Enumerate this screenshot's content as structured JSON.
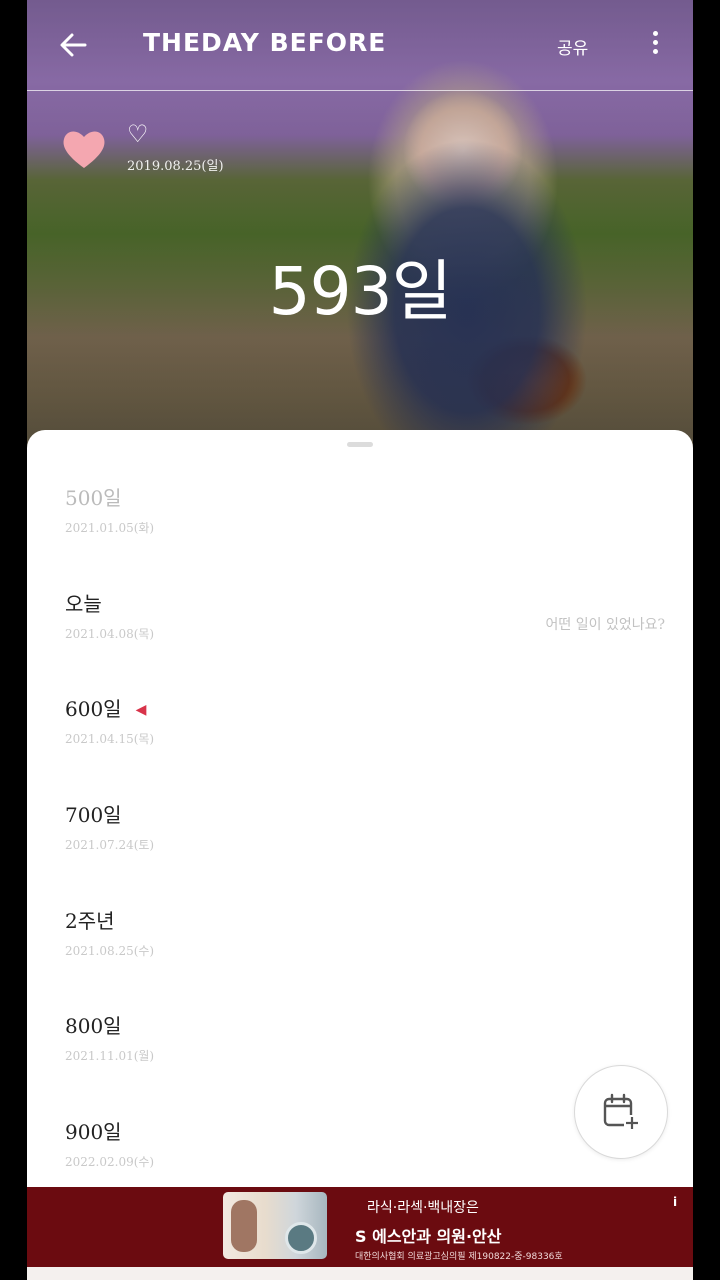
{
  "header": {
    "brand": "THEDAY BEFORE",
    "share_label": "공유"
  },
  "hero": {
    "title_icon": "♡",
    "start_date": "2019.08.25(일)",
    "count_text": "593일"
  },
  "milestones": [
    {
      "title": "500일",
      "date": "2021.01.05(화)",
      "state": "past"
    },
    {
      "title": "오늘",
      "date": "2021.04.08(목)",
      "note": "어떤 일이 있었나요?"
    },
    {
      "title": "600일",
      "date": "2021.04.15(목)",
      "flag": "◀"
    },
    {
      "title": "700일",
      "date": "2021.07.24(토)"
    },
    {
      "title": "2주년",
      "date": "2021.08.25(수)"
    },
    {
      "title": "800일",
      "date": "2021.11.01(월)"
    },
    {
      "title": "900일",
      "date": "2022.02.09(수)"
    }
  ],
  "ad": {
    "line1": "라식·라섹·백내장은",
    "line2": "S 에스안과 의원·안산",
    "line3": "대한의사협회 의료광고심의필 제190822-중-98336호",
    "info_icon": "i"
  },
  "icons": {
    "back": "back-arrow-icon",
    "more": "more-vertical-icon",
    "heart": "heart-icon",
    "add_calendar": "calendar-add-icon"
  },
  "colors": {
    "heart": "#f4a7b0",
    "flag": "#d8334a",
    "ad_background": "#6b0b10"
  }
}
